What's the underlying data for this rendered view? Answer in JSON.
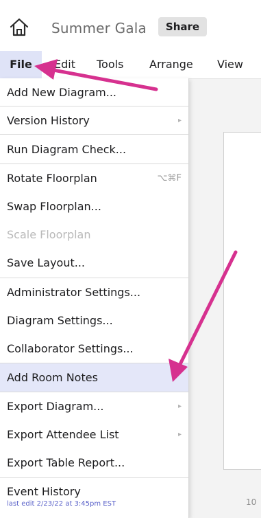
{
  "header": {
    "title": "Summer Gala",
    "share_label": "Share"
  },
  "menubar": {
    "items": [
      "File",
      "Edit",
      "Tools",
      "Arrange",
      "View"
    ]
  },
  "file_menu": {
    "items": [
      {
        "label": "Add New Diagram..."
      },
      {
        "label": "Version History",
        "submenu": true
      },
      {
        "label": "Run Diagram Check..."
      },
      {
        "label": "Rotate Floorplan",
        "shortcut": "⌥⌘F"
      },
      {
        "label": "Swap Floorplan..."
      },
      {
        "label": "Scale Floorplan",
        "disabled": true
      },
      {
        "label": "Save Layout..."
      },
      {
        "label": "Administrator Settings..."
      },
      {
        "label": "Diagram Settings..."
      },
      {
        "label": "Collaborator Settings..."
      },
      {
        "label": "Add Room Notes",
        "highlighted": true
      },
      {
        "label": "Export Diagram...",
        "submenu": true
      },
      {
        "label": "Export Attendee List",
        "submenu": true
      },
      {
        "label": "Export Table Report..."
      },
      {
        "label": "Event History",
        "sublabel": "last edit 2/23/22 at 3:45pm EST"
      }
    ]
  },
  "canvas": {
    "scale_text": "10"
  },
  "colors": {
    "annotation_arrow": "#d6318f",
    "menu_highlight": "#e4e7f9",
    "history_link": "#5a62c9"
  }
}
